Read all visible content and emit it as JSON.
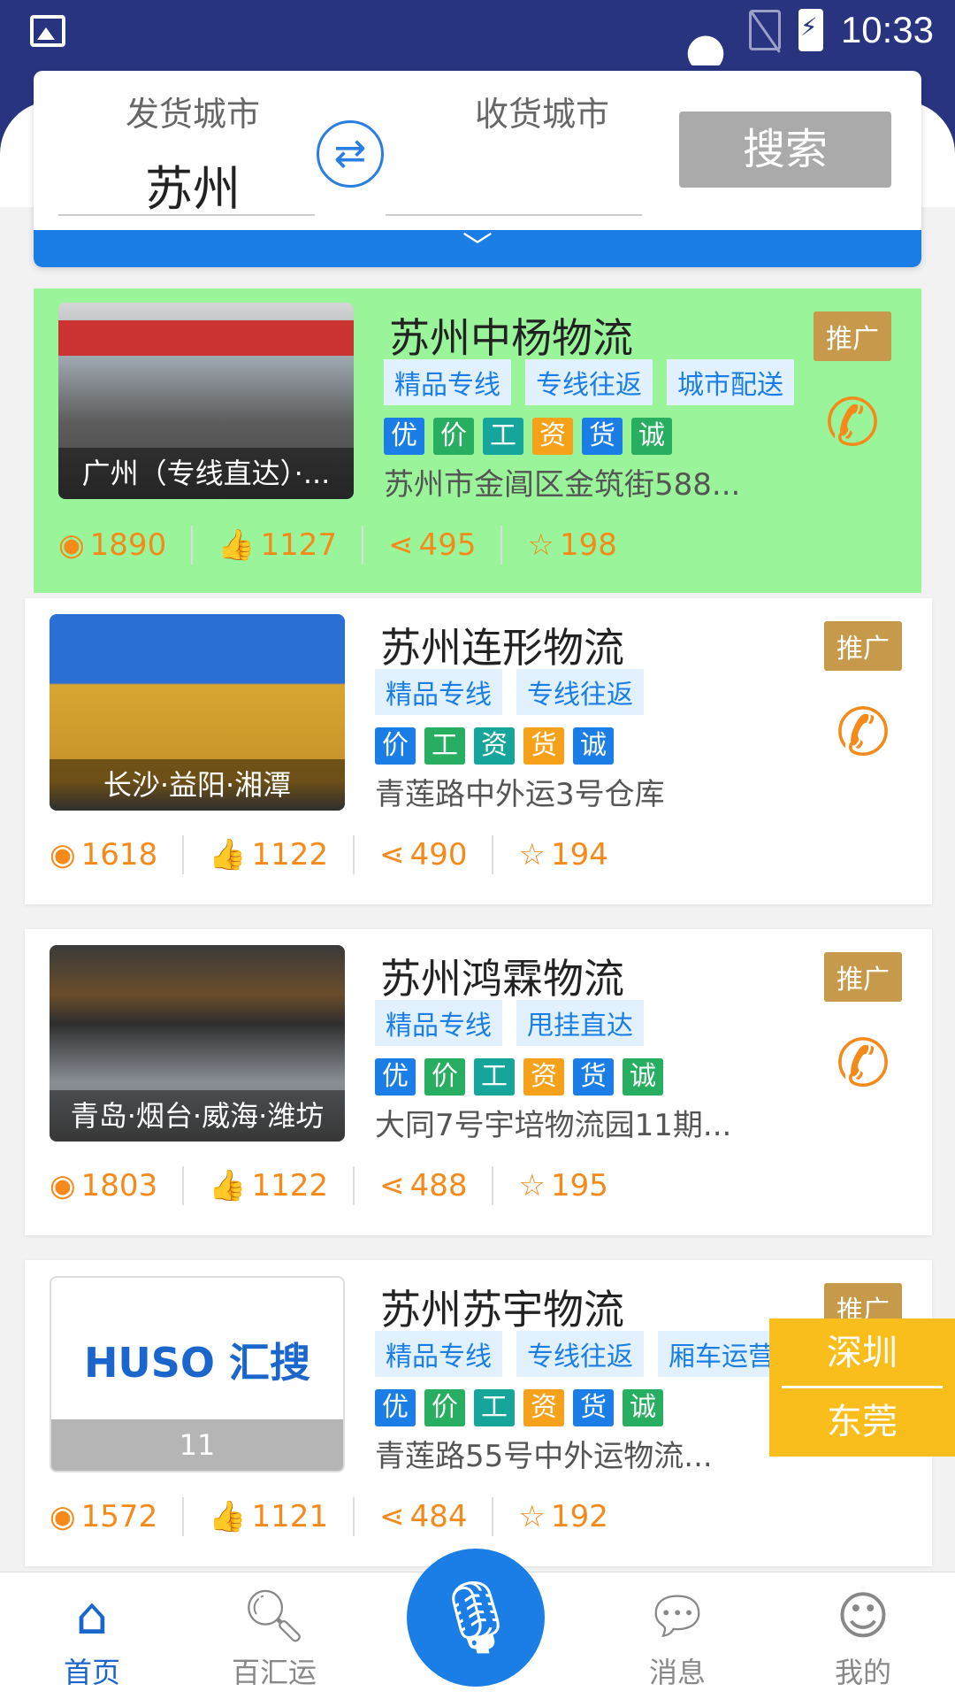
{
  "status": {
    "time": "10:33"
  },
  "search": {
    "from_label": "发货城市",
    "from_value": "苏州",
    "to_label": "收货城市",
    "to_value": "",
    "search_label": "搜索"
  },
  "listings": [
    {
      "name": "苏州中杨物流",
      "caption": "广州（专线直达）·...",
      "tags": [
        "精品专线",
        "专线往返",
        "城市配送"
      ],
      "badges": [
        "优",
        "价",
        "工",
        "资",
        "货",
        "诚"
      ],
      "address": "苏州市金阊区金筑街588...",
      "promo": "推广",
      "views": "1890",
      "likes": "1127",
      "shares": "495",
      "stars": "198"
    },
    {
      "name": "苏州连形物流",
      "caption": "长沙·益阳·湘潭",
      "tags": [
        "精品专线",
        "专线往返"
      ],
      "badges": [
        "价",
        "工",
        "资",
        "货",
        "诚"
      ],
      "address": "青莲路中外运3号仓库",
      "promo": "推广",
      "views": "1618",
      "likes": "1122",
      "shares": "490",
      "stars": "194"
    },
    {
      "name": "苏州鸿霖物流",
      "caption": "青岛·烟台·威海·潍坊",
      "tags": [
        "精品专线",
        "甩挂直达"
      ],
      "badges": [
        "优",
        "价",
        "工",
        "资",
        "货",
        "诚"
      ],
      "address": "大同7号宇培物流园11期...",
      "promo": "推广",
      "views": "1803",
      "likes": "1122",
      "shares": "488",
      "stars": "195"
    },
    {
      "name": "苏州苏宇物流",
      "caption": "11",
      "tags": [
        "精品专线",
        "专线往返",
        "厢车运营"
      ],
      "badges": [
        "优",
        "价",
        "工",
        "资",
        "货",
        "诚"
      ],
      "address": "青莲路55号中外运物流...",
      "promo": "推广",
      "views": "1572",
      "likes": "1121",
      "shares": "484",
      "stars": "192"
    }
  ],
  "logo_text": "HUSO 汇搜",
  "float_cities": [
    "深圳",
    "东莞"
  ],
  "tabs": [
    {
      "label": "首页",
      "icon": "home-icon"
    },
    {
      "label": "百汇运",
      "icon": "search-icon"
    },
    {
      "label": "消息",
      "icon": "message-icon"
    },
    {
      "label": "我的",
      "icon": "profile-icon"
    }
  ]
}
